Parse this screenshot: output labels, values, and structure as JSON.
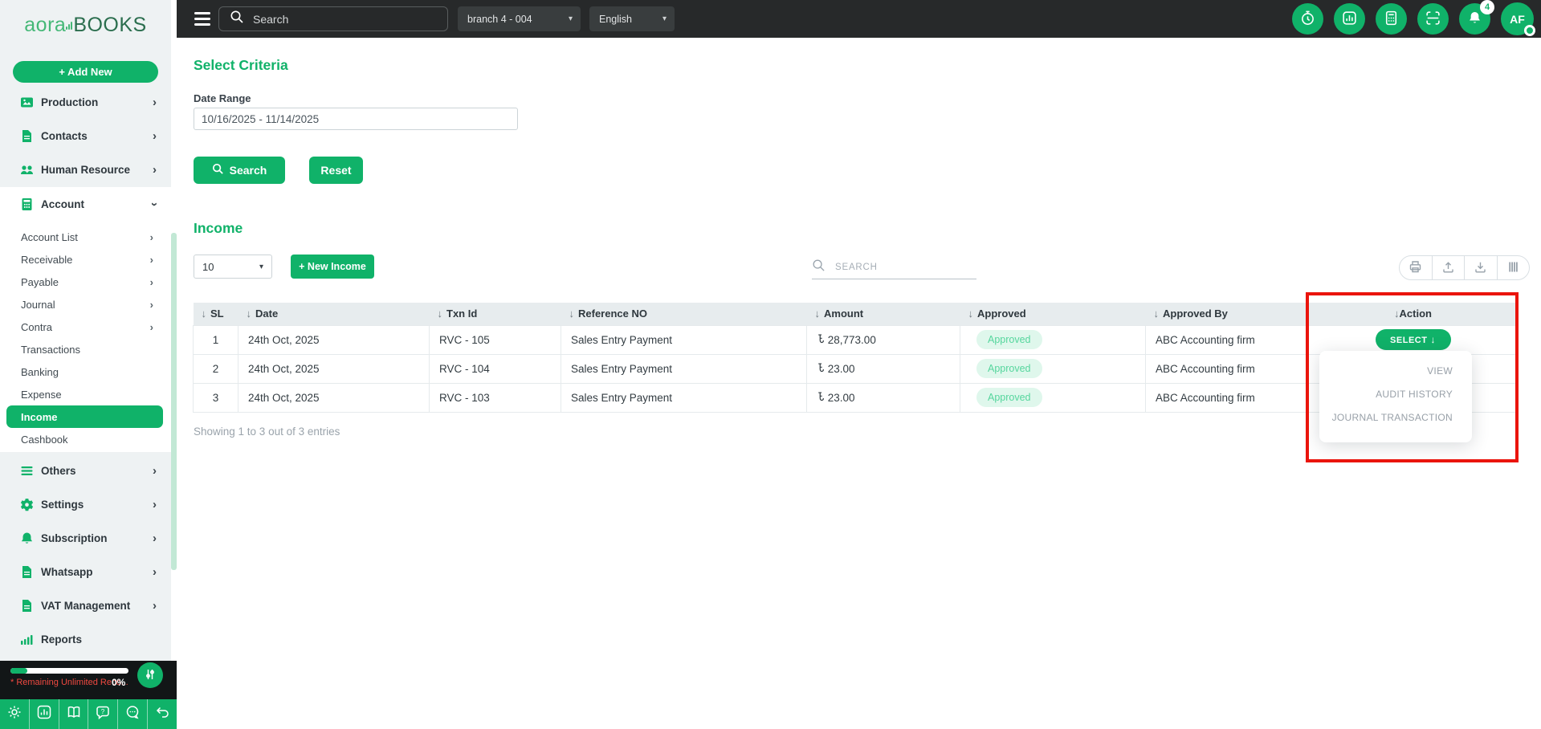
{
  "brand": {
    "logo_prefix": "aora",
    "logo_suffix": "BOOKS"
  },
  "sidebar": {
    "add_new": "+ Add New",
    "production": "Production",
    "contacts": "Contacts",
    "human_resource": "Human Resource",
    "account": "Account",
    "account_sub": [
      "Account List",
      "Receivable",
      "Payable",
      "Journal",
      "Contra",
      "Transactions",
      "Banking",
      "Expense",
      "Income",
      "Cashbook"
    ],
    "others": "Others",
    "settings": "Settings",
    "subscription": "Subscription",
    "whatsapp": "Whatsapp",
    "vat": "VAT Management",
    "reports": "Reports",
    "usage_note": "* Remaining Unlimited Reco...",
    "usage_percent": "0%"
  },
  "topbar": {
    "search_placeholder": "Search",
    "branch": "branch 4 - 004",
    "language": "English",
    "notification_count": "4",
    "avatar_initials": "AF"
  },
  "criteria": {
    "title": "Select Criteria",
    "date_label": "Date Range",
    "date_value": "10/16/2025 - 11/14/2025",
    "search_button": "Search",
    "reset_button": "Reset"
  },
  "income": {
    "title": "Income",
    "page_size": "10",
    "new_income_button": "+ New Income",
    "search_placeholder": "SEARCH",
    "showing": "Showing 1 to 3 out of 3 entries"
  },
  "table": {
    "headers": [
      "SL",
      "Date",
      "Txn Id",
      "Reference NO",
      "Amount",
      "Approved",
      "Approved By",
      "Action"
    ],
    "currency": "৳",
    "rows": [
      {
        "sl": "1",
        "date": "24th Oct, 2025",
        "txn_id": "RVC - 105",
        "reference": "Sales Entry Payment",
        "amount": "28,773.00",
        "approved": "Approved",
        "approved_by": "ABC Accounting firm"
      },
      {
        "sl": "2",
        "date": "24th Oct, 2025",
        "txn_id": "RVC - 104",
        "reference": "Sales Entry Payment",
        "amount": "23.00",
        "approved": "Approved",
        "approved_by": "ABC Accounting firm"
      },
      {
        "sl": "3",
        "date": "24th Oct, 2025",
        "txn_id": "RVC - 103",
        "reference": "Sales Entry Payment",
        "amount": "23.00",
        "approved": "Approved",
        "approved_by": "ABC Accounting firm"
      }
    ]
  },
  "action_menu": {
    "select_label": "SELECT",
    "items": [
      "VIEW",
      "AUDIT HISTORY",
      "JOURNAL TRANSACTION"
    ]
  },
  "icons": {
    "sort": "↓",
    "caret": "▾",
    "chevron": "›",
    "select_arrow": "↓"
  },
  "colors": {
    "primary_green": "#10b269",
    "sidebar_bg": "#eef2f3",
    "topbar_bg": "#27292a",
    "table_header_bg": "#e7ecee",
    "badge_bg": "#dff7ec",
    "badge_text": "#55d69d",
    "annotation_red": "#ea140c"
  }
}
